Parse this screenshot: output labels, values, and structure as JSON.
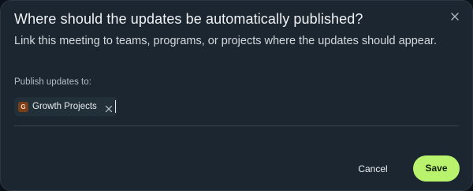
{
  "dialog": {
    "title": "Where should the updates be automatically published?",
    "subtitle": "Link this meeting to teams, programs, or projects where the updates should appear.",
    "close_icon": "close-icon"
  },
  "publish_field": {
    "label": "Publish updates to:",
    "chips": [
      {
        "avatar_letter": "G",
        "label": "Growth Projects",
        "remove_icon": "close-icon"
      }
    ]
  },
  "footer": {
    "cancel_label": "Cancel",
    "save_label": "Save"
  },
  "colors": {
    "background": "#1b2630",
    "accent": "#b9f36d",
    "chip_avatar": "#7a3e18"
  }
}
